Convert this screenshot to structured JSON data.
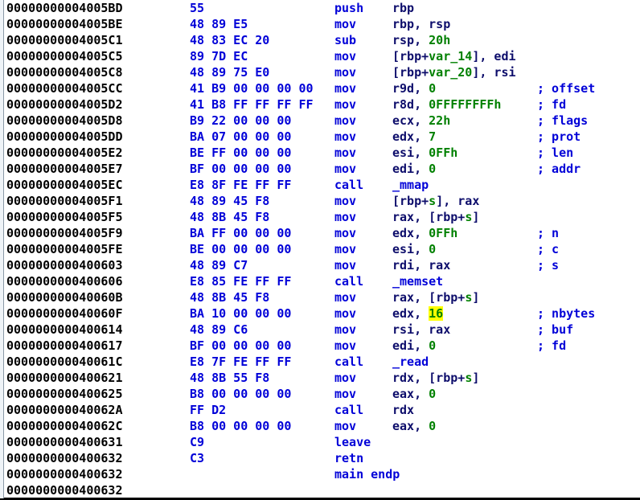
{
  "view": {
    "name": "disassembly-listing",
    "function_label": "main endp",
    "highlight": {
      "text": "16",
      "background": "#ffff00",
      "foreground": "#008000"
    },
    "colors": {
      "address": "#000000",
      "bytes": "#0000d8",
      "mnemonic": "#0000d8",
      "operand": "#0d0d6b",
      "constant": "#008000",
      "comment": "#0000d8",
      "background": "#ffffff",
      "gutter": "#eef3f7"
    }
  },
  "lines": [
    {
      "addr": "00000000004005BD",
      "bytes": "55",
      "mnem": "push",
      "ops": [
        {
          "t": "push-op",
          "v": "rbp",
          "c": "ops"
        }
      ],
      "comment": ""
    },
    {
      "addr": "00000000004005BE",
      "bytes": "48 89 E5",
      "mnem": "mov",
      "ops": [
        {
          "t": "dst",
          "v": "rbp, rsp",
          "c": "ops"
        }
      ],
      "comment": ""
    },
    {
      "addr": "00000000004005C1",
      "bytes": "48 83 EC 20",
      "mnem": "sub",
      "ops": [
        {
          "t": "dst",
          "v": "rsp, ",
          "c": "ops"
        },
        {
          "t": "imm",
          "v": "20h",
          "c": "num"
        }
      ],
      "comment": ""
    },
    {
      "addr": "00000000004005C5",
      "bytes": "89 7D EC",
      "mnem": "mov",
      "ops": [
        {
          "t": "dst",
          "v": "[rbp+",
          "c": "ops"
        },
        {
          "t": "var",
          "v": "var_14",
          "c": "var"
        },
        {
          "t": "rest",
          "v": "], edi",
          "c": "ops"
        }
      ],
      "comment": ""
    },
    {
      "addr": "00000000004005C8",
      "bytes": "48 89 75 E0",
      "mnem": "mov",
      "ops": [
        {
          "t": "dst",
          "v": "[rbp+",
          "c": "ops"
        },
        {
          "t": "var",
          "v": "var_20",
          "c": "var"
        },
        {
          "t": "rest",
          "v": "], rsi",
          "c": "ops"
        }
      ],
      "comment": ""
    },
    {
      "addr": "00000000004005CC",
      "bytes": "41 B9 00 00 00 00",
      "mnem": "mov",
      "ops": [
        {
          "t": "dst",
          "v": "r9d, ",
          "c": "ops"
        },
        {
          "t": "imm",
          "v": "0",
          "c": "num"
        }
      ],
      "comment": "; offset"
    },
    {
      "addr": "00000000004005D2",
      "bytes": "41 B8 FF FF FF FF",
      "mnem": "mov",
      "ops": [
        {
          "t": "dst",
          "v": "r8d, ",
          "c": "ops"
        },
        {
          "t": "imm",
          "v": "0FFFFFFFFh",
          "c": "num"
        }
      ],
      "comment": "; fd"
    },
    {
      "addr": "00000000004005D8",
      "bytes": "B9 22 00 00 00",
      "mnem": "mov",
      "ops": [
        {
          "t": "dst",
          "v": "ecx, ",
          "c": "ops"
        },
        {
          "t": "imm",
          "v": "22h",
          "c": "num"
        }
      ],
      "comment": "; flags"
    },
    {
      "addr": "00000000004005DD",
      "bytes": "BA 07 00 00 00",
      "mnem": "mov",
      "ops": [
        {
          "t": "dst",
          "v": "edx, ",
          "c": "ops"
        },
        {
          "t": "imm",
          "v": "7",
          "c": "num"
        }
      ],
      "comment": "; prot"
    },
    {
      "addr": "00000000004005E2",
      "bytes": "BE FF 00 00 00",
      "mnem": "mov",
      "ops": [
        {
          "t": "dst",
          "v": "esi, ",
          "c": "ops"
        },
        {
          "t": "imm",
          "v": "0FFh",
          "c": "num"
        }
      ],
      "comment": "; len"
    },
    {
      "addr": "00000000004005E7",
      "bytes": "BF 00 00 00 00",
      "mnem": "mov",
      "ops": [
        {
          "t": "dst",
          "v": "edi, ",
          "c": "ops"
        },
        {
          "t": "imm",
          "v": "0",
          "c": "num"
        }
      ],
      "comment": "; addr"
    },
    {
      "addr": "00000000004005EC",
      "bytes": "E8 8F FE FF FF",
      "mnem": "call",
      "ops": [
        {
          "t": "target",
          "v": "_mmap",
          "c": "call-target"
        }
      ],
      "comment": ""
    },
    {
      "addr": "00000000004005F1",
      "bytes": "48 89 45 F8",
      "mnem": "mov",
      "ops": [
        {
          "t": "dst",
          "v": "[rbp+",
          "c": "ops"
        },
        {
          "t": "var",
          "v": "s",
          "c": "var"
        },
        {
          "t": "rest",
          "v": "], rax",
          "c": "ops"
        }
      ],
      "comment": ""
    },
    {
      "addr": "00000000004005F5",
      "bytes": "48 8B 45 F8",
      "mnem": "mov",
      "ops": [
        {
          "t": "dst",
          "v": "rax, [rbp+",
          "c": "ops"
        },
        {
          "t": "var",
          "v": "s",
          "c": "var"
        },
        {
          "t": "rest",
          "v": "]",
          "c": "ops"
        }
      ],
      "comment": ""
    },
    {
      "addr": "00000000004005F9",
      "bytes": "BA FF 00 00 00",
      "mnem": "mov",
      "ops": [
        {
          "t": "dst",
          "v": "edx, ",
          "c": "ops"
        },
        {
          "t": "imm",
          "v": "0FFh",
          "c": "num"
        }
      ],
      "comment": "; n"
    },
    {
      "addr": "00000000004005FE",
      "bytes": "BE 00 00 00 00",
      "mnem": "mov",
      "ops": [
        {
          "t": "dst",
          "v": "esi, ",
          "c": "ops"
        },
        {
          "t": "imm",
          "v": "0",
          "c": "num"
        }
      ],
      "comment": "; c"
    },
    {
      "addr": "0000000000400603",
      "bytes": "48 89 C7",
      "mnem": "mov",
      "ops": [
        {
          "t": "dst",
          "v": "rdi, rax",
          "c": "ops"
        }
      ],
      "comment": "; s"
    },
    {
      "addr": "0000000000400606",
      "bytes": "E8 85 FE FF FF",
      "mnem": "call",
      "ops": [
        {
          "t": "target",
          "v": "_memset",
          "c": "call-target"
        }
      ],
      "comment": ""
    },
    {
      "addr": "000000000040060B",
      "bytes": "48 8B 45 F8",
      "mnem": "mov",
      "ops": [
        {
          "t": "dst",
          "v": "rax, [rbp+",
          "c": "ops"
        },
        {
          "t": "var",
          "v": "s",
          "c": "var"
        },
        {
          "t": "rest",
          "v": "]",
          "c": "ops"
        }
      ],
      "comment": ""
    },
    {
      "addr": "000000000040060F",
      "bytes": "BA 10 00 00 00",
      "mnem": "mov",
      "ops": [
        {
          "t": "dst",
          "v": "edx, ",
          "c": "ops"
        },
        {
          "t": "imm",
          "v": "16",
          "c": "hl"
        }
      ],
      "comment": "; nbytes"
    },
    {
      "addr": "0000000000400614",
      "bytes": "48 89 C6",
      "mnem": "mov",
      "ops": [
        {
          "t": "dst",
          "v": "rsi, rax",
          "c": "ops"
        }
      ],
      "comment": "; buf"
    },
    {
      "addr": "0000000000400617",
      "bytes": "BF 00 00 00 00",
      "mnem": "mov",
      "ops": [
        {
          "t": "dst",
          "v": "edi, ",
          "c": "ops"
        },
        {
          "t": "imm",
          "v": "0",
          "c": "num"
        }
      ],
      "comment": "; fd"
    },
    {
      "addr": "000000000040061C",
      "bytes": "E8 7F FE FF FF",
      "mnem": "call",
      "ops": [
        {
          "t": "target",
          "v": "_read",
          "c": "call-target"
        }
      ],
      "comment": ""
    },
    {
      "addr": "0000000000400621",
      "bytes": "48 8B 55 F8",
      "mnem": "mov",
      "ops": [
        {
          "t": "dst",
          "v": "rdx, [rbp+",
          "c": "ops"
        },
        {
          "t": "var",
          "v": "s",
          "c": "var"
        },
        {
          "t": "rest",
          "v": "]",
          "c": "ops"
        }
      ],
      "comment": ""
    },
    {
      "addr": "0000000000400625",
      "bytes": "B8 00 00 00 00",
      "mnem": "mov",
      "ops": [
        {
          "t": "dst",
          "v": "eax, ",
          "c": "ops"
        },
        {
          "t": "imm",
          "v": "0",
          "c": "num"
        }
      ],
      "comment": ""
    },
    {
      "addr": "000000000040062A",
      "bytes": "FF D2",
      "mnem": "call",
      "ops": [
        {
          "t": "dst",
          "v": "rdx",
          "c": "ops"
        }
      ],
      "comment": ""
    },
    {
      "addr": "000000000040062C",
      "bytes": "B8 00 00 00 00",
      "mnem": "mov",
      "ops": [
        {
          "t": "dst",
          "v": "eax, ",
          "c": "ops"
        },
        {
          "t": "imm",
          "v": "0",
          "c": "num"
        }
      ],
      "comment": ""
    },
    {
      "addr": "0000000000400631",
      "bytes": "C9",
      "mnem": "leave",
      "ops": [],
      "comment": ""
    },
    {
      "addr": "0000000000400632",
      "bytes": "C3",
      "mnem": "retn",
      "ops": [],
      "comment": ""
    },
    {
      "addr": "0000000000400632",
      "bytes": "",
      "mnem": "",
      "ops": [
        {
          "t": "endp",
          "v": "main endp",
          "c": "endp"
        }
      ],
      "comment": ""
    },
    {
      "addr": "0000000000400632",
      "bytes": "",
      "mnem": "",
      "ops": [],
      "comment": ""
    }
  ]
}
